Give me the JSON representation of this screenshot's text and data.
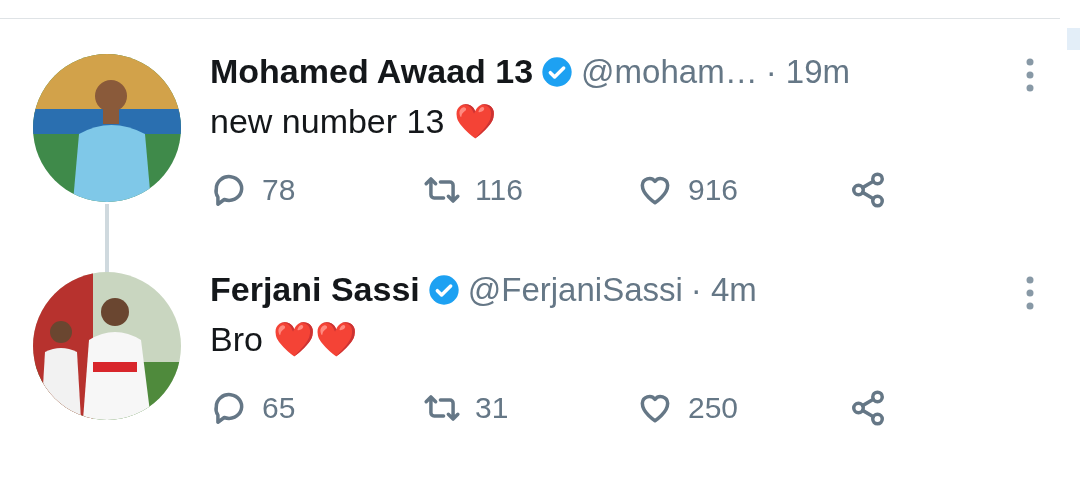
{
  "tweets": [
    {
      "name": "Mohamed Awaad 13",
      "verified": true,
      "handle": "@moham…",
      "time": "· 19m",
      "text": "new number 13",
      "emoji": "❤️",
      "thread_line": true,
      "replies": "78",
      "retweets": "116",
      "likes": "916"
    },
    {
      "name": "Ferjani Sassi",
      "verified": true,
      "handle": "@FerjaniSassi",
      "time": "· 4m",
      "text": "Bro",
      "emoji": "❤️❤️",
      "thread_line": false,
      "replies": "65",
      "retweets": "31",
      "likes": "250"
    }
  ]
}
